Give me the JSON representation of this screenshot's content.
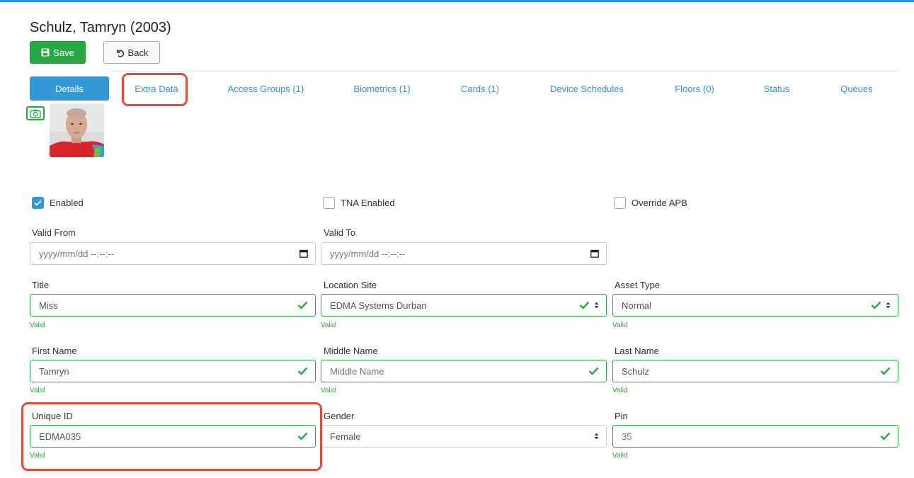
{
  "page": {
    "title": "Schulz, Tamryn (2003)"
  },
  "toolbar": {
    "save_label": "Save",
    "back_label": "Back"
  },
  "tabs": [
    {
      "label": "Details"
    },
    {
      "label": "Extra Data"
    },
    {
      "label": "Access Groups (1)"
    },
    {
      "label": "Biometrics (1)"
    },
    {
      "label": "Cards (1)"
    },
    {
      "label": "Device Schedules"
    },
    {
      "label": "Floors (0)"
    },
    {
      "label": "Status"
    },
    {
      "label": "Queues"
    }
  ],
  "checkboxes": [
    {
      "label": "Enabled",
      "checked": true
    },
    {
      "label": "TNA Enabled",
      "checked": false
    },
    {
      "label": "Override APB",
      "checked": false
    }
  ],
  "fields": {
    "valid_from": {
      "label": "Valid From",
      "placeholder": "yyyy/mm/dd --:--:--"
    },
    "valid_to": {
      "label": "Valid To",
      "placeholder": "yyyy/mm/dd --:--:--"
    },
    "title": {
      "label": "Title",
      "value": "Miss",
      "status": "Valid"
    },
    "location_site": {
      "label": "Location Site",
      "value": "EDMA Systems Durban",
      "status": "Valid"
    },
    "asset_type": {
      "label": "Asset Type",
      "value": "Normal",
      "status": "Valid"
    },
    "first_name": {
      "label": "First Name",
      "value": "Tamryn",
      "status": "Valid"
    },
    "middle_name": {
      "label": "Middle Name",
      "placeholder": "Middle Name",
      "status": "Valid"
    },
    "last_name": {
      "label": "Last Name",
      "value": "Schulz",
      "status": "Valid"
    },
    "unique_id": {
      "label": "Unique ID",
      "value": "EDMA035",
      "status": "Valid"
    },
    "gender": {
      "label": "Gender",
      "value": "Female"
    },
    "pin": {
      "label": "Pin",
      "value": "35",
      "status": "Valid"
    }
  },
  "colors": {
    "accent": "#3399d6",
    "success": "#28a745",
    "highlight": "#d9503f"
  }
}
